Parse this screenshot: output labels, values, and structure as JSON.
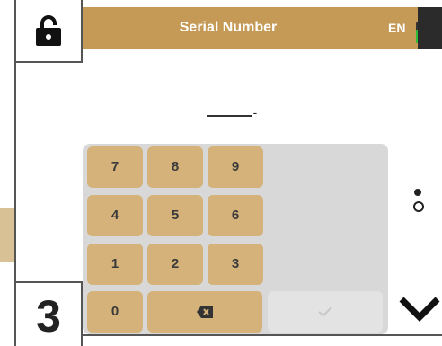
{
  "header": {
    "title": "Serial Number",
    "language": "EN",
    "battery_level": 0.65,
    "accent_color": "#c49a56",
    "battery_color": "#2dbb3a"
  },
  "lock": {
    "icon": "lock-open-icon"
  },
  "serial": {
    "value": "-"
  },
  "keypad": {
    "keys": [
      "7",
      "8",
      "9",
      "4",
      "5",
      "6",
      "1",
      "2",
      "3",
      "0"
    ],
    "backspace_icon": "backspace-icon",
    "ok_icon": "check-icon",
    "key_color": "#d4b27a"
  },
  "step": {
    "number": "3"
  },
  "nav": {
    "next_icon": "chevron-down-icon",
    "cursor_icon": "dots-icon"
  }
}
